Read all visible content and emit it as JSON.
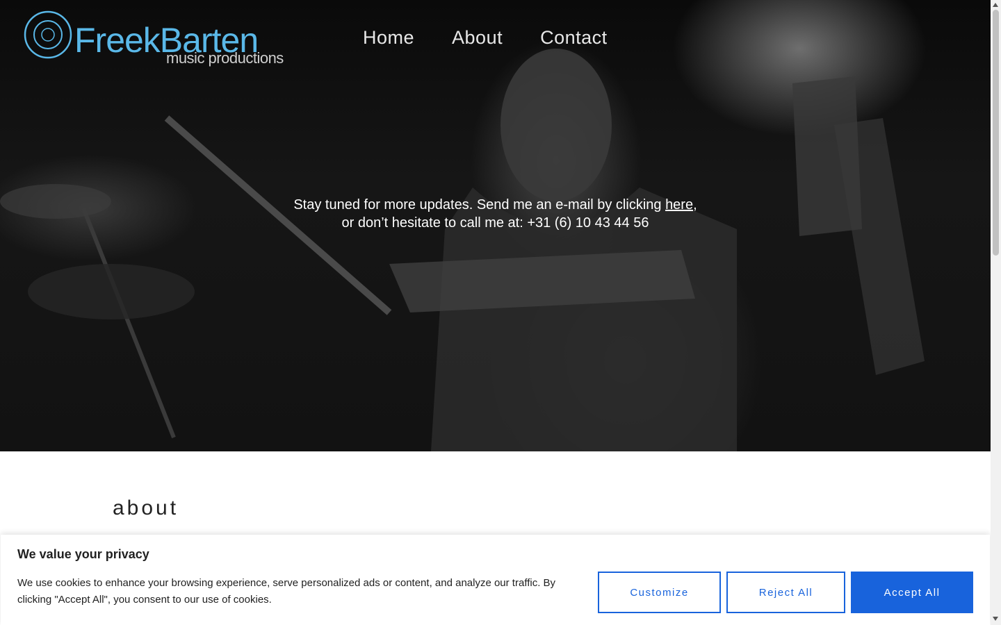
{
  "header": {
    "logo_name": "FreekBarten",
    "logo_sub": "music productions",
    "nav": [
      {
        "label": "Home"
      },
      {
        "label": "About"
      },
      {
        "label": "Contact"
      }
    ]
  },
  "hero": {
    "line1_before": "Stay tuned for more updates. Send me an e-mail by clicking ",
    "link_text": "here",
    "line1_after": ",",
    "line2": "or don’t hesitate to call me at: +31 (6) 10 43 44 56"
  },
  "about": {
    "heading": "about"
  },
  "cookie": {
    "title": "We value your privacy",
    "text": "We use cookies to enhance your browsing experience, serve personalized ads or content, and analyze our traffic. By clicking \"Accept All\", you consent to our use of cookies.",
    "customize_label": "Customize",
    "reject_label": "Reject All",
    "accept_label": "Accept All"
  },
  "colors": {
    "logo_accent": "#5ab8e8",
    "button_blue": "#1863dc"
  },
  "icons": {
    "logo": "concentric-circles-icon"
  }
}
